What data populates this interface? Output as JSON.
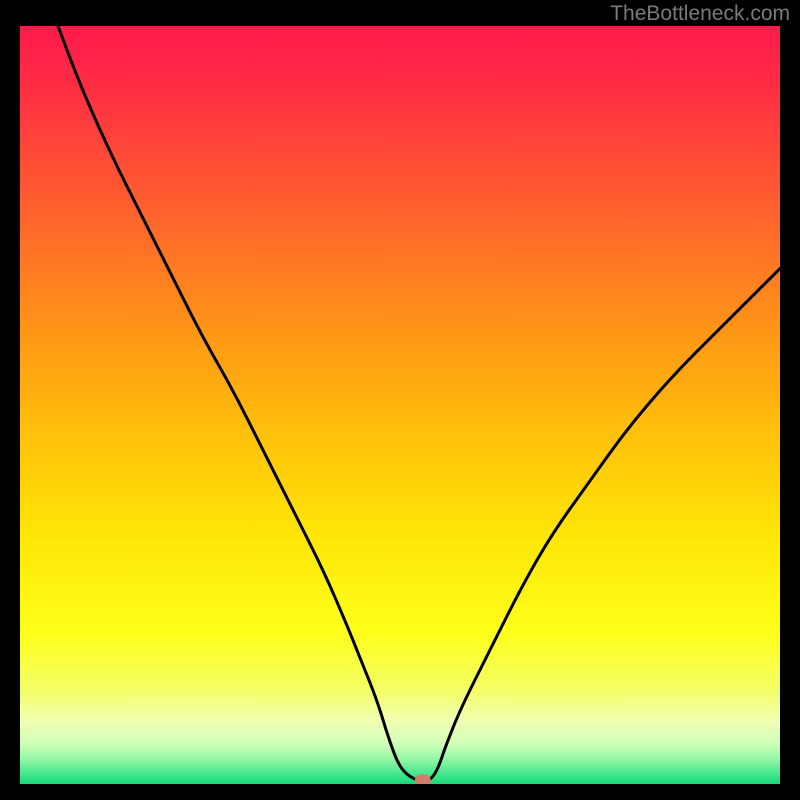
{
  "watermark": "TheBottleneck.com",
  "chart_data": {
    "type": "line",
    "title": "",
    "xlabel": "",
    "ylabel": "",
    "xlim": [
      0,
      100
    ],
    "ylim": [
      0,
      100
    ],
    "grid": false,
    "series": [
      {
        "name": "curve",
        "x": [
          5,
          8,
          12,
          16,
          20,
          24,
          28,
          32,
          36,
          40,
          43,
          45,
          47,
          48.5,
          50,
          52,
          53,
          54,
          55,
          56,
          58,
          62,
          66,
          70,
          75,
          80,
          86,
          92,
          98,
          100
        ],
        "y": [
          100,
          92,
          83,
          75,
          67,
          59,
          52,
          44,
          36,
          28,
          21,
          16,
          11,
          6,
          2,
          0.5,
          0.5,
          0.5,
          2,
          5,
          10,
          18,
          26,
          33,
          40,
          47,
          54,
          60,
          66,
          68
        ]
      }
    ],
    "marker": {
      "x": 53,
      "y": 0.5,
      "color": "#d47c6a"
    },
    "background_gradient": {
      "stops": [
        {
          "offset": 0.0,
          "color": "#ff1a4b"
        },
        {
          "offset": 0.07,
          "color": "#ff2a45"
        },
        {
          "offset": 0.18,
          "color": "#ff4d36"
        },
        {
          "offset": 0.3,
          "color": "#ff7426"
        },
        {
          "offset": 0.42,
          "color": "#ff9b14"
        },
        {
          "offset": 0.55,
          "color": "#ffc409"
        },
        {
          "offset": 0.68,
          "color": "#ffe708"
        },
        {
          "offset": 0.8,
          "color": "#fdff1a"
        },
        {
          "offset": 0.875,
          "color": "#f5ff66"
        },
        {
          "offset": 0.915,
          "color": "#f2ffb0"
        },
        {
          "offset": 0.945,
          "color": "#d3ffb8"
        },
        {
          "offset": 0.965,
          "color": "#9cf8a8"
        },
        {
          "offset": 0.985,
          "color": "#4be88f"
        },
        {
          "offset": 1.0,
          "color": "#18d877"
        }
      ]
    }
  }
}
